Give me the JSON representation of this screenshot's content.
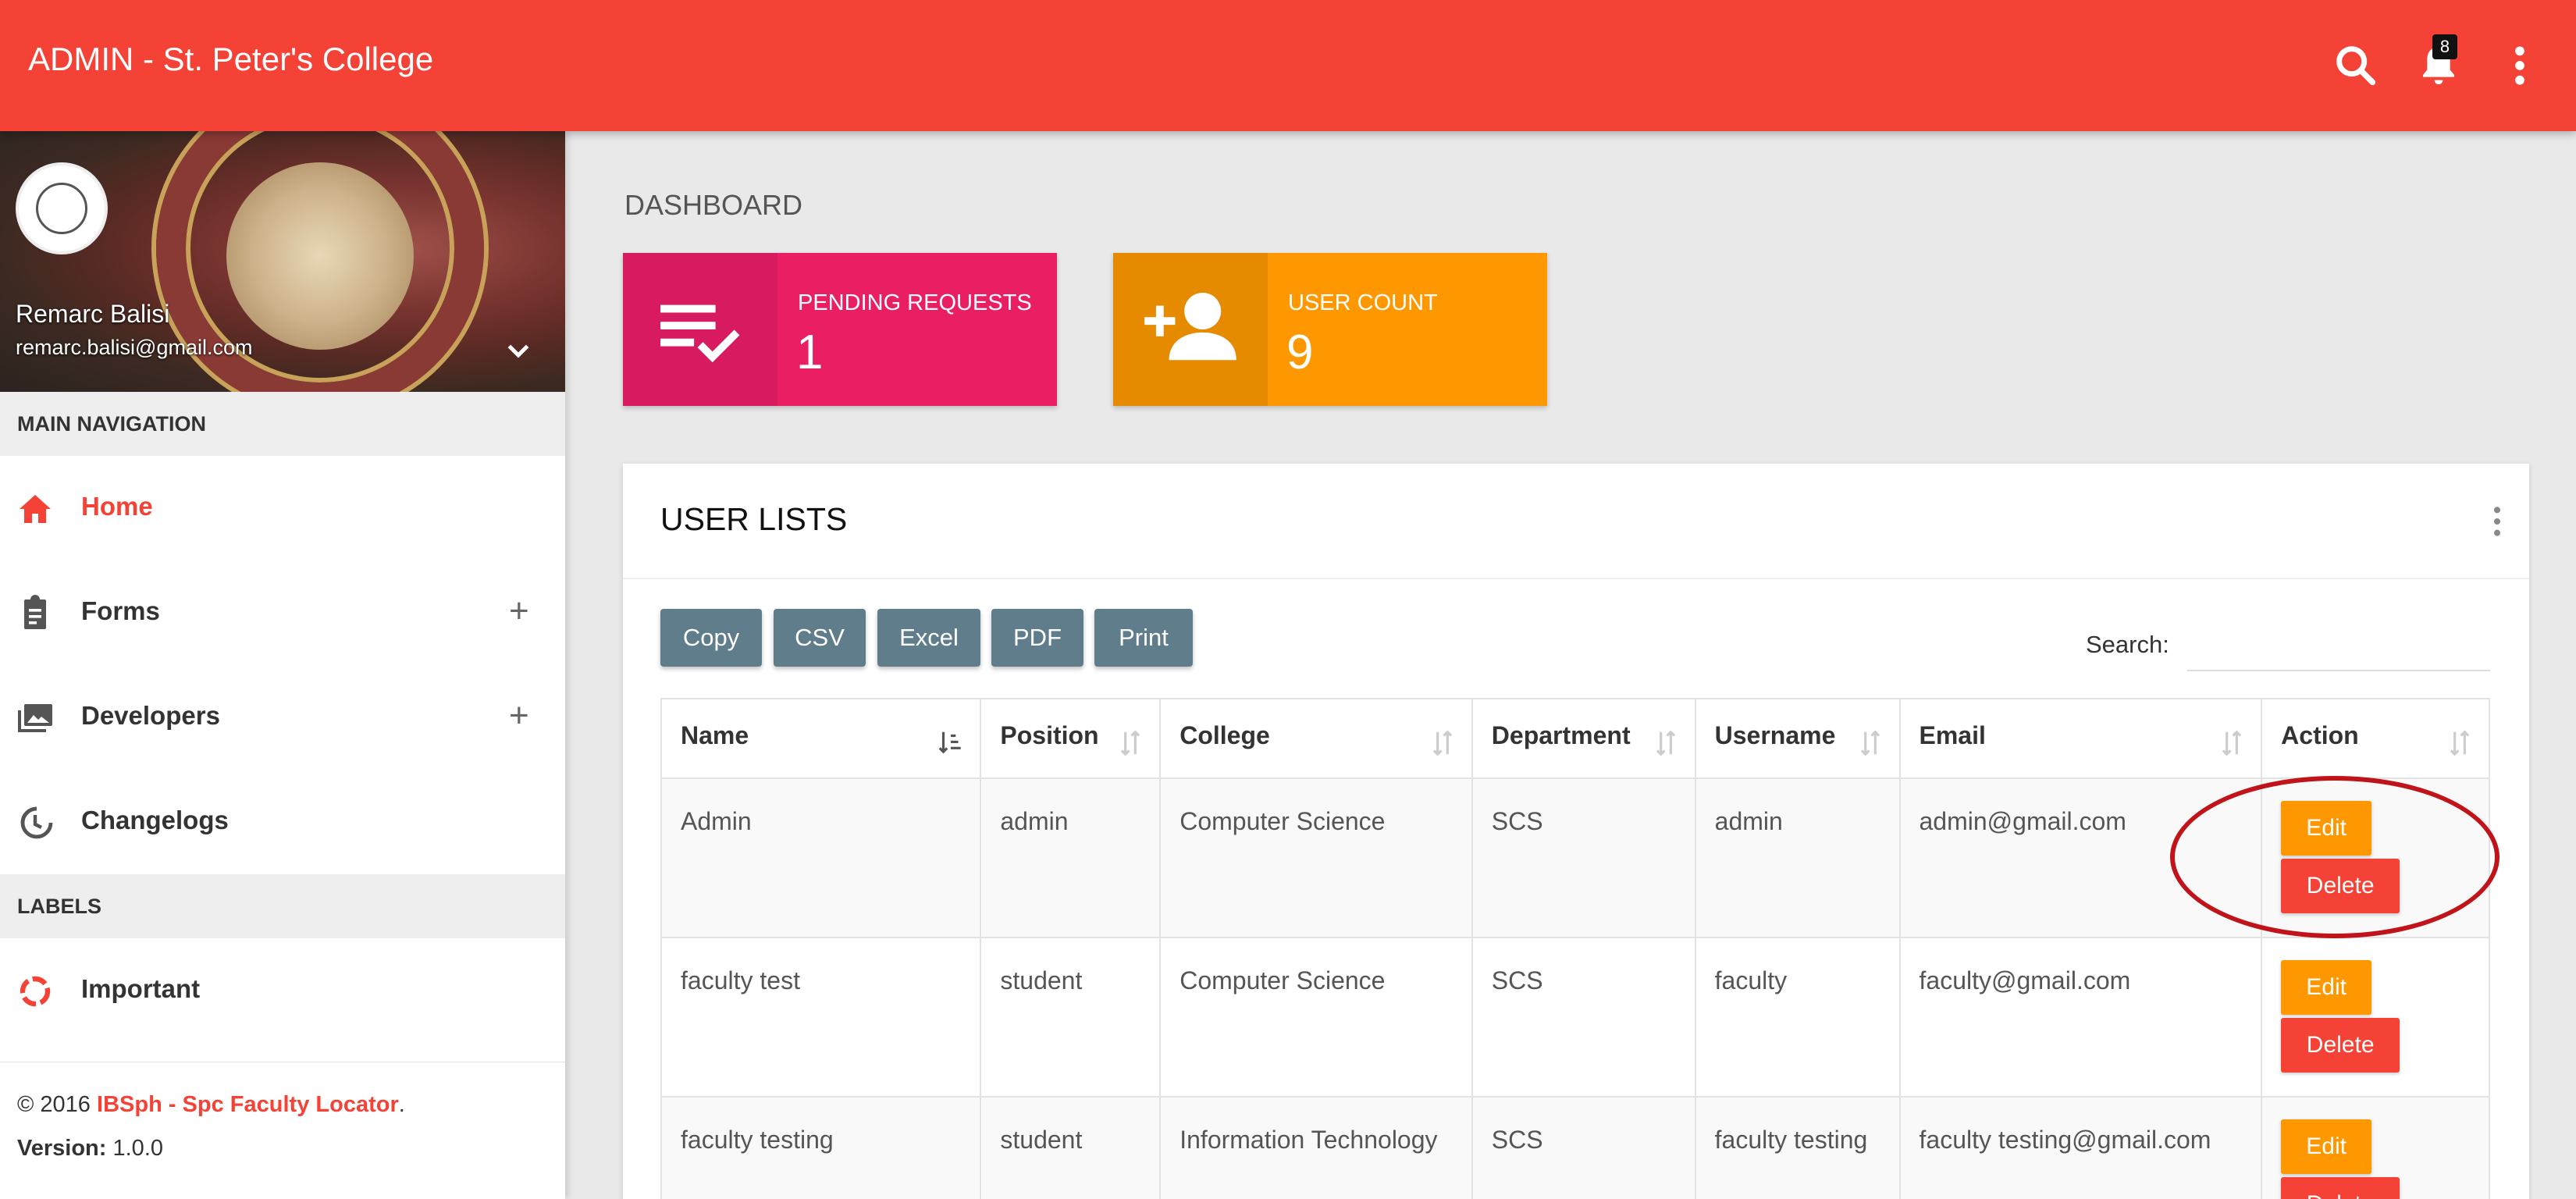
{
  "header": {
    "title": "ADMIN - St. Peter's College",
    "notification_count": "8",
    "search_icon": "search-icon",
    "bell_icon": "bell-icon",
    "menu_icon": "more-vert-icon",
    "color": "#f44336"
  },
  "sidebar": {
    "user": {
      "name": "Remarc Balisi",
      "email": "remarc.balisi@gmail.com"
    },
    "main_nav_header": "MAIN NAVIGATION",
    "items": [
      {
        "label": "Home",
        "icon": "home-icon",
        "active": true
      },
      {
        "label": "Forms",
        "icon": "clipboard-icon",
        "expandable": true,
        "expander": "+"
      },
      {
        "label": "Developers",
        "icon": "photo-library-icon",
        "expandable": true,
        "expander": "+"
      },
      {
        "label": "Changelogs",
        "icon": "history-icon"
      }
    ],
    "labels_header": "LABELS",
    "labels": [
      {
        "label": "Important",
        "icon": "donut-icon",
        "color": "#f44336"
      }
    ],
    "footer": {
      "copyright": "© 2016",
      "brand": "IBSph - Spc Faculty Locator",
      "period": ".",
      "version_label": "Version:",
      "version": "1.0.0"
    }
  },
  "main": {
    "page_title": "DASHBOARD",
    "info_boxes": [
      {
        "text": "PENDING REQUESTS",
        "number": "1",
        "icon": "playlist-check-icon",
        "color": "#e91e63",
        "icon_bg": "#d81b60"
      },
      {
        "text": "USER COUNT",
        "number": "9",
        "icon": "person-add-icon",
        "color": "#ff9800",
        "icon_bg": "#e68a00"
      }
    ],
    "user_list": {
      "title": "USER LISTS",
      "buttons": [
        "Copy",
        "CSV",
        "Excel",
        "PDF",
        "Print"
      ],
      "search_label": "Search:",
      "search_value": "",
      "columns": [
        "Name",
        "Position",
        "College",
        "Department",
        "Username",
        "Email",
        "Action"
      ],
      "rows": [
        {
          "name": "Admin",
          "position": "admin",
          "college": "Computer Science",
          "department": "SCS",
          "username": "admin",
          "email": "admin@gmail.com"
        },
        {
          "name": "faculty test",
          "position": "student",
          "college": "Computer Science",
          "department": "SCS",
          "username": "faculty",
          "email": "faculty@gmail.com"
        },
        {
          "name": "faculty testing",
          "position": "student",
          "college": "Information Technology",
          "department": "SCS",
          "username": "faculty testing",
          "email": "faculty testing@gmail.com"
        }
      ],
      "edit_label": "Edit",
      "delete_label": "Delete"
    }
  },
  "colors": {
    "edit": "#ff9800",
    "delete": "#f44336",
    "table_button": "#607d8b",
    "annotation": "#c0141a"
  }
}
